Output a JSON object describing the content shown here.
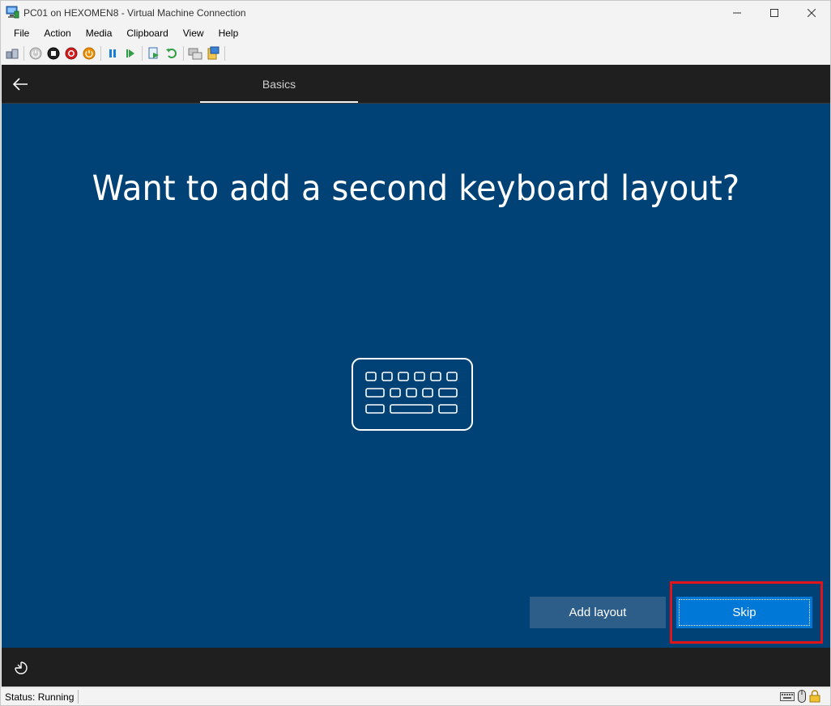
{
  "window": {
    "title": "PC01 on HEXOMEN8 - Virtual Machine Connection"
  },
  "menu": {
    "items": [
      "File",
      "Action",
      "Media",
      "Clipboard",
      "View",
      "Help"
    ]
  },
  "toolbar": {
    "icons": [
      "ctrl-alt-del-icon",
      "start-icon",
      "turn-off-icon",
      "shut-down-icon",
      "power-icon",
      "pause-icon",
      "resume-icon",
      "checkpoint-icon",
      "revert-icon",
      "enhanced-session-icon",
      "share-icon"
    ]
  },
  "oobe": {
    "tab_label": "Basics",
    "question": "Want to add a second keyboard layout?",
    "add_layout_label": "Add layout",
    "skip_label": "Skip"
  },
  "statusbar": {
    "status_text": "Status: Running"
  },
  "colors": {
    "vm_background": "#004275",
    "primary_button": "#0078d7",
    "secondary_button": "#2d5d89",
    "highlight": "#e3131a"
  }
}
